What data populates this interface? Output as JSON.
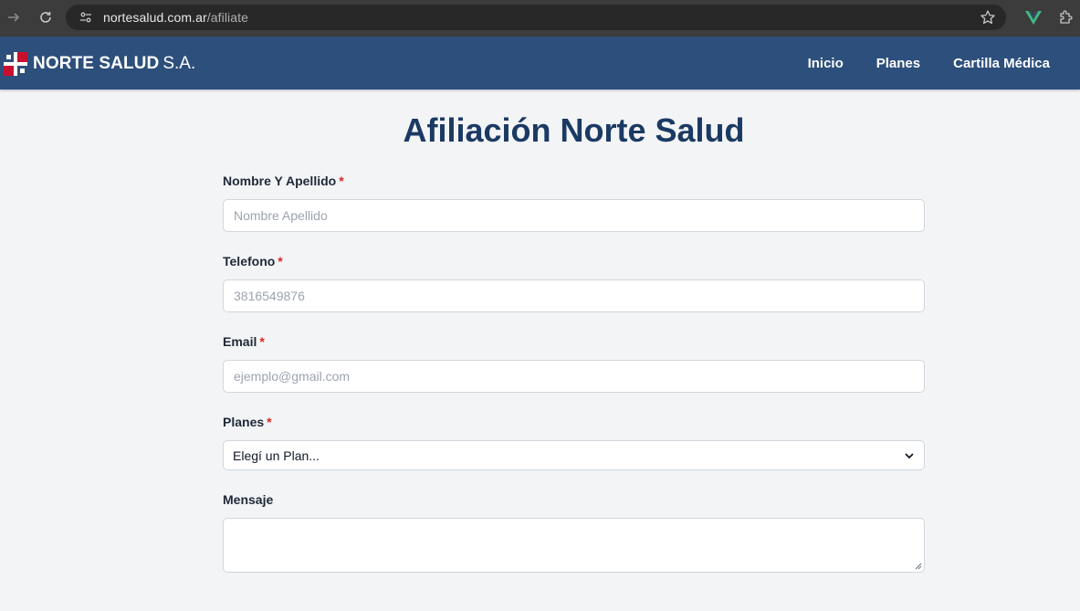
{
  "browser": {
    "url_host": "nortesalud.com.ar",
    "url_path": "/afiliate"
  },
  "header": {
    "logo_name": "NORTE SALUD",
    "logo_suffix": "S.A.",
    "nav": [
      "Inicio",
      "Planes",
      "Cartilla Médica"
    ]
  },
  "page": {
    "title": "Afiliación Norte Salud"
  },
  "form": {
    "required_mark": "*",
    "name": {
      "label": "Nombre Y Apellido",
      "placeholder": "Nombre Apellido"
    },
    "phone": {
      "label": "Telefono",
      "placeholder": "3816549876"
    },
    "email": {
      "label": "Email",
      "placeholder": "ejemplo@gmail.com"
    },
    "plan": {
      "label": "Planes",
      "selected": "Elegí un Plan..."
    },
    "message": {
      "label": "Mensaje"
    }
  },
  "colors": {
    "header_bg": "#2d4f7c",
    "title": "#1b3a63",
    "required": "#dc2626",
    "page_bg": "#f3f4f6"
  }
}
